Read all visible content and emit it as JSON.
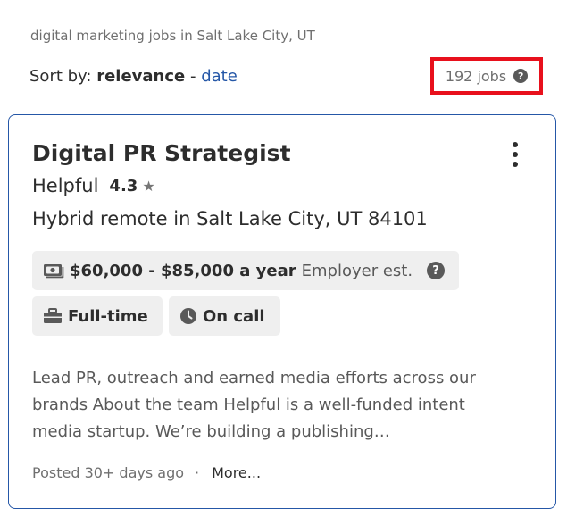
{
  "search_caption": "digital marketing jobs in Salt Lake City, UT",
  "sort": {
    "label": "Sort by:",
    "relevance": "relevance",
    "separator": "-",
    "date": "date"
  },
  "job_count": {
    "text": "192 jobs",
    "help_icon": "question-circle-icon",
    "highlight_color": "#e8101c"
  },
  "job": {
    "title": "Digital PR Strategist",
    "menu_icon": "kebab-menu-icon",
    "company": "Helpful",
    "rating": "4.3",
    "rating_icon": "star-icon",
    "location": "Hybrid remote in Salt Lake City, UT 84101",
    "salary": {
      "icon": "money-icon",
      "amount": "$60,000 - $85,000 a year",
      "note": "Employer est.",
      "help_icon": "question-circle-icon"
    },
    "tags": [
      {
        "icon": "briefcase-icon",
        "label": "Full-time"
      },
      {
        "icon": "clock-icon",
        "label": "On call"
      }
    ],
    "snippet": "Lead PR, outreach and earned media efforts across our brands About the team Helpful is a well-funded intent media startup. We’re building a publishing…",
    "posted": "Posted 30+ days ago",
    "dot": "·",
    "more": "More..."
  },
  "colors": {
    "link": "#2557a7",
    "card_border": "#2557a7",
    "chip_bg": "#efefef"
  }
}
